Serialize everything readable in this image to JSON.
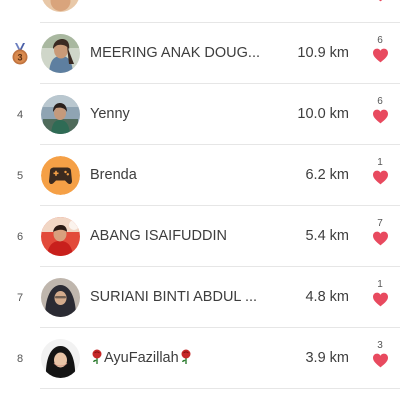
{
  "colors": {
    "heart": "#e84a5f",
    "divider": "#e6e6e6",
    "bronze_medal": "#c0733f",
    "controller_bg": "#f5a046"
  },
  "rows": [
    {
      "rank": "",
      "name": "",
      "distance": "",
      "likes": "",
      "avatar": "partial-avatar"
    },
    {
      "rank": "3",
      "name": "MEERING ANAK DOUG...",
      "distance": "10.9 km",
      "likes": "6",
      "avatar": "photo",
      "rank_icon": "bronze-medal-icon"
    },
    {
      "rank": "4",
      "name": "Yenny",
      "distance": "10.0 km",
      "likes": "6",
      "avatar": "photo"
    },
    {
      "rank": "5",
      "name": "Brenda",
      "distance": "6.2 km",
      "likes": "1",
      "avatar": "game-controller-icon"
    },
    {
      "rank": "6",
      "name": "ABANG ISAIFUDDIN",
      "distance": "5.4 km",
      "likes": "7",
      "avatar": "photo"
    },
    {
      "rank": "7",
      "name": "SURIANI BINTI ABDUL ...",
      "distance": "4.8 km",
      "likes": "1",
      "avatar": "photo"
    },
    {
      "rank": "8",
      "name": "AyuFazillah",
      "distance": "3.9 km",
      "likes": "3",
      "avatar": "photo",
      "name_decoration": "rose-icon"
    }
  ]
}
